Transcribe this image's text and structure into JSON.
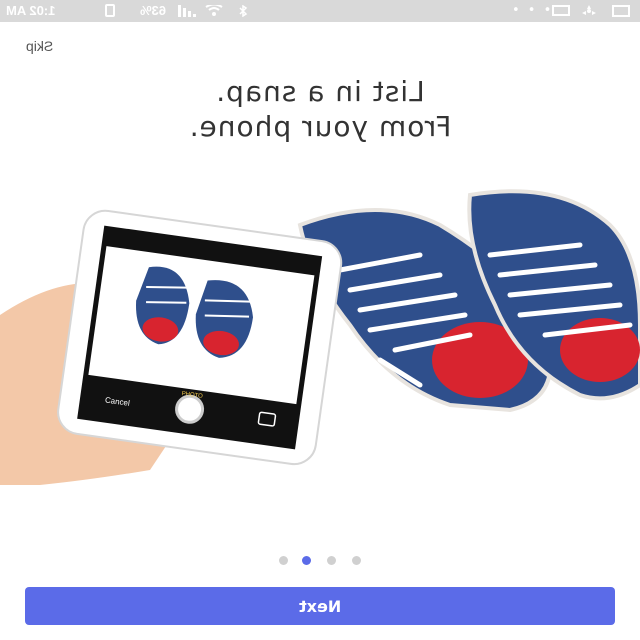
{
  "status_bar": {
    "time": "1:02 AM",
    "battery": "63%",
    "icons": [
      "battery-icon",
      "signal-icon",
      "wifi-icon",
      "bluetooth-icon",
      "more-dots-icon",
      "gallery-icon",
      "fan-icon",
      "message-icon"
    ]
  },
  "onboarding": {
    "skip_label": "Skip",
    "headline_line1": "List in a snap.",
    "headline_line2": "From your phone.",
    "illustration": "hand-holding-phone-photographing-blue-sneakers",
    "phone_camera": {
      "cancel_label": "Cancel",
      "mode_label": "PHOTO"
    },
    "page_indicator": {
      "count": 4,
      "active_index": 1
    },
    "next_label": "Next"
  },
  "colors": {
    "accent": "#5b6be8",
    "status_bar": "#d9d9d9",
    "dot_inactive": "#d0d0d0"
  }
}
